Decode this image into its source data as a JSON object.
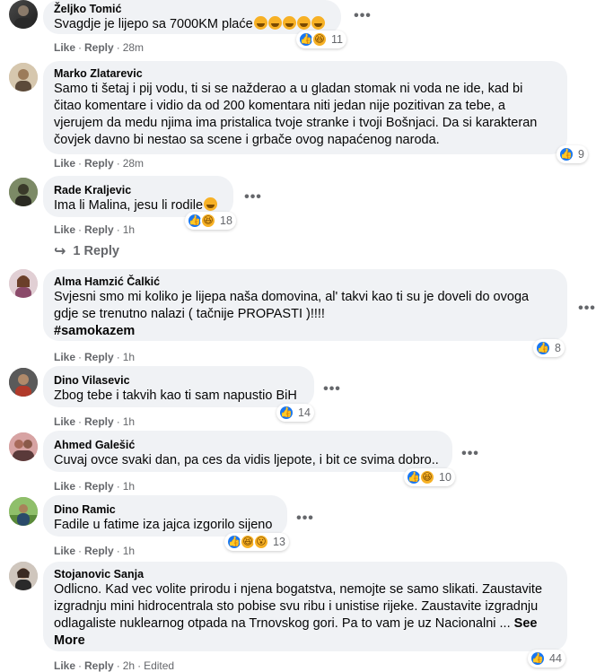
{
  "colors": {
    "like_blue": "#1877f2",
    "haha_yellow": "#f7b125",
    "bubble_bg": "#f0f2f5",
    "muted": "#65676b"
  },
  "labels": {
    "like": "Like",
    "reply": "Reply",
    "dot": "·",
    "more": "•••"
  },
  "comments": [
    {
      "author": "Željko Tomić",
      "text": "Svagdje je lijepo sa 7000KM plaće",
      "text_emoji_count": 5,
      "time": "28m",
      "reactions": [
        "like",
        "haha"
      ],
      "reaction_count": "11"
    },
    {
      "author": "Marko Zlatarevic",
      "lines": [
        "Samo ti šetaj i pij vodu, ti si se nažderao a u gladan stomak ni voda ne ide, kad bi",
        "čitao komentare i vidio da od 200 komentara niti jedan nije pozitivan za tebe, a",
        "vjerujem da medu njima ima pristalica tvoje stranke i tvoji Bošnjaci. Da si karakteran",
        "čovjek davno bi nestao sa scene i grbače ovog napaćenog naroda."
      ],
      "time": "28m",
      "reactions": [
        "like"
      ],
      "reaction_count": "9"
    },
    {
      "author": "Rade Kraljevic",
      "text": "Ima li Malina, jesu li rodile",
      "time": "1h",
      "reactions": [
        "like",
        "haha"
      ],
      "reaction_count": "18",
      "replies_label": "1 Reply"
    },
    {
      "author": "Alma Hamzić Čalkić",
      "lines": [
        "Svjesni smo mi koliko je lijepa naša domovina, al' takvi kao ti su je doveli do ovoga",
        "gdje se trenutno nalazi ( tačnije PROPASTI )!!!!"
      ],
      "hashtag": "#samokazem",
      "time": "1h",
      "reactions": [
        "like"
      ],
      "reaction_count": "8"
    },
    {
      "author": "Dino Vilasevic",
      "text": "Zbog tebe i takvih kao ti sam napustio BiH",
      "time": "1h",
      "reactions": [
        "like"
      ],
      "reaction_count": "14"
    },
    {
      "author": "Ahmed Galešić",
      "text": "Cuvaj ovce svaki dan, pa ces da vidis ljepote, i bit ce svima dobro..",
      "time": "1h",
      "reactions": [
        "like",
        "haha"
      ],
      "reaction_count": "10"
    },
    {
      "author": "Dino Ramic",
      "text": "Fadile u fatime iza jajca izgorilo sijeno",
      "time": "1h",
      "reactions": [
        "like",
        "haha",
        "wow"
      ],
      "reaction_count": "13"
    },
    {
      "author": "Stojanovic Sanja",
      "lines": [
        "Odlicno. Kad vec volite prirodu i njena bogatstva, nemojte se samo slikati. Zaustavite",
        "izgradnju mini hidrocentrala sto pobise svu ribu i unistise rijeke. Zaustavite izgradnju",
        "odlagaliste nuklearnog otpada na Trnovskog gori. Pa to vam je uz Nacionalni ..."
      ],
      "see_more": "See More",
      "time": "2h",
      "edited": "Edited",
      "reactions": [
        "like"
      ],
      "reaction_count": "44"
    }
  ]
}
